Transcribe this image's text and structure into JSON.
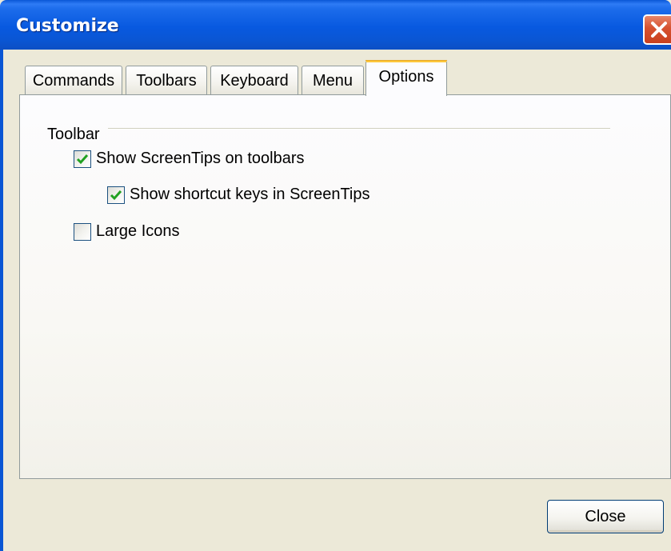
{
  "window": {
    "title": "Customize"
  },
  "title_bar": {
    "close_icon": "close-x-icon",
    "close_color": "#D6512F",
    "title_bar_color": "#0A56D4"
  },
  "tabs": [
    {
      "label": "Commands",
      "active": false
    },
    {
      "label": "Toolbars",
      "active": false
    },
    {
      "label": "Keyboard",
      "active": false
    },
    {
      "label": "Menu",
      "active": false
    },
    {
      "label": "Options",
      "active": true
    }
  ],
  "active_tab_accent": "#FFC83C",
  "options": {
    "group_label": "Toolbar",
    "show_screentips": {
      "label": "Show ScreenTips on toolbars",
      "checked": true
    },
    "show_shortcut_keys": {
      "label": "Show shortcut keys in ScreenTips",
      "checked": true
    },
    "large_icons": {
      "label": "Large Icons",
      "checked": false
    },
    "check_color": "#21A121"
  },
  "footer": {
    "close_label": "Close"
  }
}
